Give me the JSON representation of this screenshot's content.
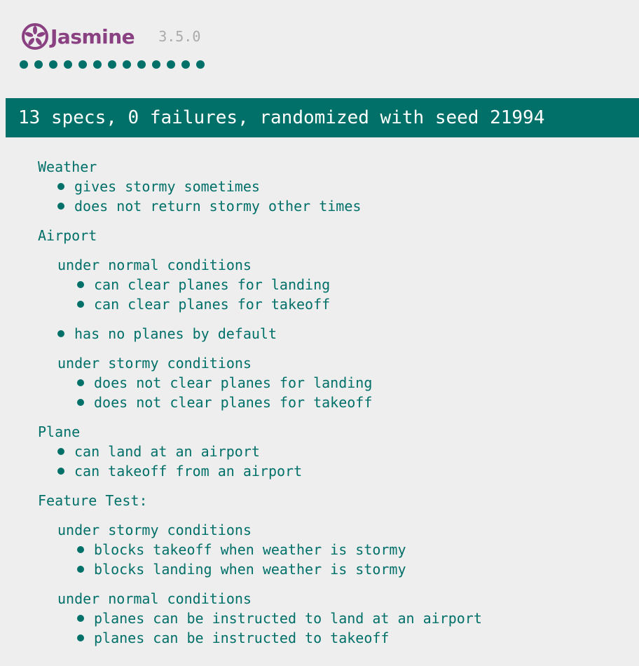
{
  "banner": {
    "title": "Jasmine",
    "version": "3.5.0",
    "logo_icon": "jasmine-flower-icon",
    "brand_color": "#8a4182"
  },
  "progress": {
    "passed_count": 13,
    "dot_color": "#007069"
  },
  "summary": {
    "text": "13 specs, 0 failures, randomized with seed 21994",
    "bar_color": "#007069"
  },
  "suites": {
    "weather": {
      "title": "Weather",
      "specs": [
        "gives stormy sometimes",
        "does not return stormy other times"
      ]
    },
    "airport": {
      "title": "Airport",
      "normal": {
        "title": "under normal conditions",
        "specs": [
          "can clear planes for landing",
          "can clear planes for takeoff"
        ]
      },
      "specs": [
        "has no planes by default"
      ],
      "stormy": {
        "title": "under stormy conditions",
        "specs": [
          "does not clear planes for landing",
          "does not clear planes for takeoff"
        ]
      }
    },
    "plane": {
      "title": "Plane",
      "specs": [
        "can land at an airport",
        "can takeoff from an airport"
      ]
    },
    "feature": {
      "title": "Feature Test:",
      "stormy": {
        "title": "under stormy conditions",
        "specs": [
          "blocks takeoff when weather is stormy",
          "blocks landing when weather is stormy"
        ]
      },
      "normal": {
        "title": "under normal conditions",
        "specs": [
          "planes can be instructed to land at an airport",
          "planes can be instructed to takeoff"
        ]
      }
    }
  }
}
